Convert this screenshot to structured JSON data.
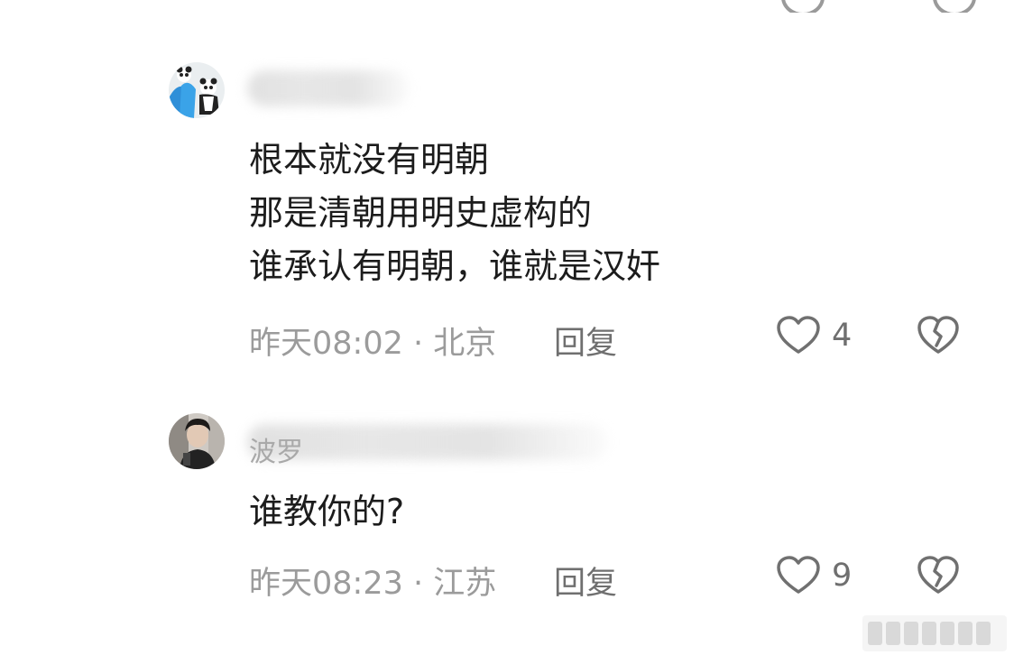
{
  "comments": [
    {
      "username": "",
      "lines": [
        "根本就没有明朝",
        "那是清朝用明史虚构的",
        "谁承认有明朝，谁就是汉奸"
      ],
      "time": "昨天08:02",
      "location": "北京",
      "reply_label": "回复",
      "likes": "4"
    },
    {
      "username": "波罗",
      "lines": [
        "谁教你的?"
      ],
      "time": "昨天08:23",
      "location": "江苏",
      "reply_label": "回复",
      "likes": "9"
    }
  ],
  "icons": {
    "like": "heart-outline-icon",
    "dislike": "broken-heart-icon"
  },
  "colors": {
    "text": "#1c1c1c",
    "meta": "#9b9b9b",
    "action": "#6f6f6f"
  }
}
